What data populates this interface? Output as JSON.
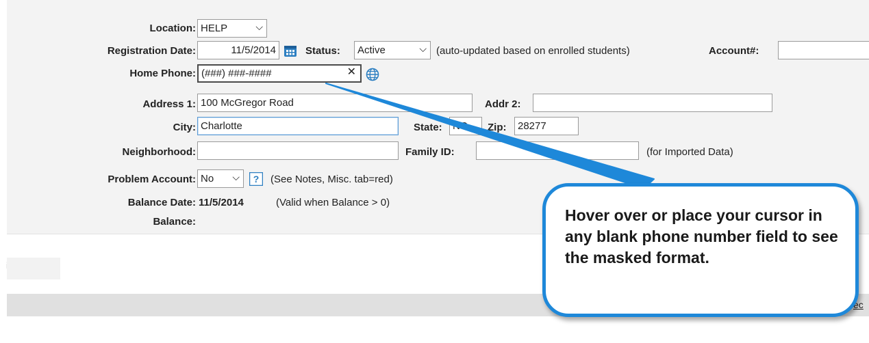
{
  "form": {
    "location_label": "Location:",
    "location_value": "HELP",
    "registration_date_label": "Registration Date:",
    "registration_date_value": "11/5/2014",
    "status_label": "Status:",
    "status_value": "Active",
    "status_note": "(auto-updated based on enrolled students)",
    "account_label": "Account#:",
    "account_value": "",
    "home_phone_label": "Home Phone:",
    "home_phone_mask": "(###) ###-####",
    "address1_label": "Address 1:",
    "address1_value": "100 McGregor Road",
    "addr2_label": "Addr 2:",
    "addr2_value": "",
    "city_label": "City:",
    "city_value": "Charlotte",
    "state_label": "State:",
    "state_value": "NC",
    "zip_label": "Zip:",
    "zip_value": "28277",
    "neighborhood_label": "Neighborhood:",
    "neighborhood_value": "",
    "family_id_label": "Family ID:",
    "family_id_value": "",
    "family_id_note": "(for Imported Data)",
    "problem_account_label": "Problem Account:",
    "problem_account_value": "No",
    "problem_account_note": "(See Notes, Misc. tab=red)",
    "balance_date_label": "Balance Date:",
    "balance_date_value": "11/5/2014",
    "balance_date_note": "(Valid when Balance > 0)",
    "balance_label": "Balance:"
  },
  "callout": {
    "text": "Hover over or place your cursor in any blank phone number field to see the masked format.",
    "color": "#1e88d9"
  },
  "partial": {
    "edge_text": "ec",
    "tiny_mark": "i"
  },
  "icons": {
    "calendar": "calendar-icon",
    "clear": "clear-x-icon",
    "globe": "globe-icon",
    "help": "help-icon",
    "dropdown": "chevron-down-icon"
  }
}
